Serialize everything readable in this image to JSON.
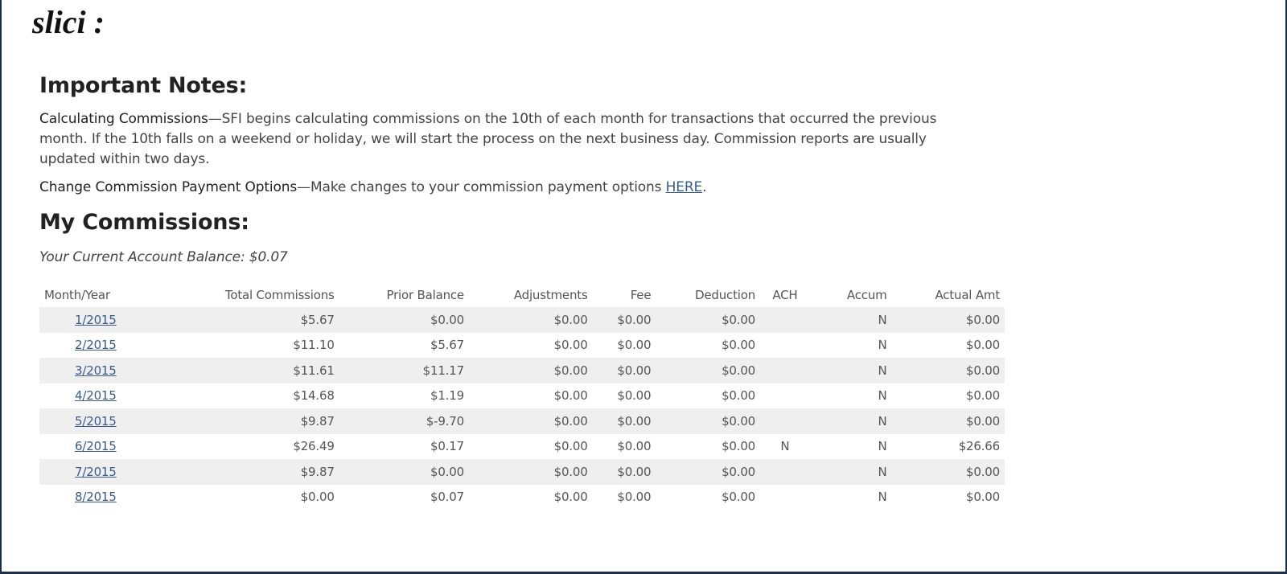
{
  "page_title": "slici :",
  "notes": {
    "heading": "Important Notes:",
    "calc_lead": "Calculating Commissions",
    "calc_dash": "—",
    "calc_text": "SFI begins calculating commissions on the 10th of each month for transactions that occurred the previous month. If the 10th falls on a weekend or holiday, we will start the process on the next business day. Commission reports are usually updated within two days.",
    "change_lead": "Change Commission Payment Options",
    "change_dash": "—",
    "change_text": "Make changes to your commission payment options ",
    "change_link": "HERE",
    "change_end": "."
  },
  "commissions": {
    "heading": "My Commissions:",
    "balance": "Your Current Account Balance: $0.07",
    "columns": {
      "month": "Month/Year",
      "total": "Total Commissions",
      "prior": "Prior Balance",
      "adj": "Adjustments",
      "fee": "Fee",
      "ded": "Deduction",
      "ach": "ACH",
      "accum": "Accum",
      "actual": "Actual Amt"
    },
    "rows": [
      {
        "month": "1/2015",
        "total": "$5.67",
        "prior": "$0.00",
        "adj": "$0.00",
        "fee": "$0.00",
        "ded": "$0.00",
        "ach": "",
        "accum": "N",
        "actual": "$0.00"
      },
      {
        "month": "2/2015",
        "total": "$11.10",
        "prior": "$5.67",
        "adj": "$0.00",
        "fee": "$0.00",
        "ded": "$0.00",
        "ach": "",
        "accum": "N",
        "actual": "$0.00"
      },
      {
        "month": "3/2015",
        "total": "$11.61",
        "prior": "$11.17",
        "adj": "$0.00",
        "fee": "$0.00",
        "ded": "$0.00",
        "ach": "",
        "accum": "N",
        "actual": "$0.00"
      },
      {
        "month": "4/2015",
        "total": "$14.68",
        "prior": "$1.19",
        "adj": "$0.00",
        "fee": "$0.00",
        "ded": "$0.00",
        "ach": "",
        "accum": "N",
        "actual": "$0.00"
      },
      {
        "month": "5/2015",
        "total": "$9.87",
        "prior": "$-9.70",
        "adj": "$0.00",
        "fee": "$0.00",
        "ded": "$0.00",
        "ach": "",
        "accum": "N",
        "actual": "$0.00"
      },
      {
        "month": "6/2015",
        "total": "$26.49",
        "prior": "$0.17",
        "adj": "$0.00",
        "fee": "$0.00",
        "ded": "$0.00",
        "ach": "N",
        "accum": "N",
        "actual": "$26.66"
      },
      {
        "month": "7/2015",
        "total": "$9.87",
        "prior": "$0.00",
        "adj": "$0.00",
        "fee": "$0.00",
        "ded": "$0.00",
        "ach": "",
        "accum": "N",
        "actual": "$0.00"
      },
      {
        "month": "8/2015",
        "total": "$0.00",
        "prior": "$0.07",
        "adj": "$0.00",
        "fee": "$0.00",
        "ded": "$0.00",
        "ach": "",
        "accum": "N",
        "actual": "$0.00"
      }
    ]
  }
}
